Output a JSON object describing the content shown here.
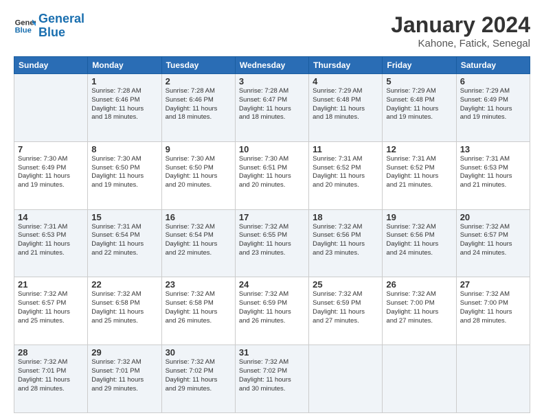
{
  "logo": {
    "text1": "General",
    "text2": "Blue"
  },
  "title": {
    "month": "January 2024",
    "location": "Kahone, Fatick, Senegal"
  },
  "headers": [
    "Sunday",
    "Monday",
    "Tuesday",
    "Wednesday",
    "Thursday",
    "Friday",
    "Saturday"
  ],
  "weeks": [
    [
      {
        "day": "",
        "info": ""
      },
      {
        "day": "1",
        "info": "Sunrise: 7:28 AM\nSunset: 6:46 PM\nDaylight: 11 hours\nand 18 minutes."
      },
      {
        "day": "2",
        "info": "Sunrise: 7:28 AM\nSunset: 6:46 PM\nDaylight: 11 hours\nand 18 minutes."
      },
      {
        "day": "3",
        "info": "Sunrise: 7:28 AM\nSunset: 6:47 PM\nDaylight: 11 hours\nand 18 minutes."
      },
      {
        "day": "4",
        "info": "Sunrise: 7:29 AM\nSunset: 6:48 PM\nDaylight: 11 hours\nand 18 minutes."
      },
      {
        "day": "5",
        "info": "Sunrise: 7:29 AM\nSunset: 6:48 PM\nDaylight: 11 hours\nand 19 minutes."
      },
      {
        "day": "6",
        "info": "Sunrise: 7:29 AM\nSunset: 6:49 PM\nDaylight: 11 hours\nand 19 minutes."
      }
    ],
    [
      {
        "day": "7",
        "info": "Sunrise: 7:30 AM\nSunset: 6:49 PM\nDaylight: 11 hours\nand 19 minutes."
      },
      {
        "day": "8",
        "info": "Sunrise: 7:30 AM\nSunset: 6:50 PM\nDaylight: 11 hours\nand 19 minutes."
      },
      {
        "day": "9",
        "info": "Sunrise: 7:30 AM\nSunset: 6:50 PM\nDaylight: 11 hours\nand 20 minutes."
      },
      {
        "day": "10",
        "info": "Sunrise: 7:30 AM\nSunset: 6:51 PM\nDaylight: 11 hours\nand 20 minutes."
      },
      {
        "day": "11",
        "info": "Sunrise: 7:31 AM\nSunset: 6:52 PM\nDaylight: 11 hours\nand 20 minutes."
      },
      {
        "day": "12",
        "info": "Sunrise: 7:31 AM\nSunset: 6:52 PM\nDaylight: 11 hours\nand 21 minutes."
      },
      {
        "day": "13",
        "info": "Sunrise: 7:31 AM\nSunset: 6:53 PM\nDaylight: 11 hours\nand 21 minutes."
      }
    ],
    [
      {
        "day": "14",
        "info": "Sunrise: 7:31 AM\nSunset: 6:53 PM\nDaylight: 11 hours\nand 21 minutes."
      },
      {
        "day": "15",
        "info": "Sunrise: 7:31 AM\nSunset: 6:54 PM\nDaylight: 11 hours\nand 22 minutes."
      },
      {
        "day": "16",
        "info": "Sunrise: 7:32 AM\nSunset: 6:54 PM\nDaylight: 11 hours\nand 22 minutes."
      },
      {
        "day": "17",
        "info": "Sunrise: 7:32 AM\nSunset: 6:55 PM\nDaylight: 11 hours\nand 23 minutes."
      },
      {
        "day": "18",
        "info": "Sunrise: 7:32 AM\nSunset: 6:56 PM\nDaylight: 11 hours\nand 23 minutes."
      },
      {
        "day": "19",
        "info": "Sunrise: 7:32 AM\nSunset: 6:56 PM\nDaylight: 11 hours\nand 24 minutes."
      },
      {
        "day": "20",
        "info": "Sunrise: 7:32 AM\nSunset: 6:57 PM\nDaylight: 11 hours\nand 24 minutes."
      }
    ],
    [
      {
        "day": "21",
        "info": "Sunrise: 7:32 AM\nSunset: 6:57 PM\nDaylight: 11 hours\nand 25 minutes."
      },
      {
        "day": "22",
        "info": "Sunrise: 7:32 AM\nSunset: 6:58 PM\nDaylight: 11 hours\nand 25 minutes."
      },
      {
        "day": "23",
        "info": "Sunrise: 7:32 AM\nSunset: 6:58 PM\nDaylight: 11 hours\nand 26 minutes."
      },
      {
        "day": "24",
        "info": "Sunrise: 7:32 AM\nSunset: 6:59 PM\nDaylight: 11 hours\nand 26 minutes."
      },
      {
        "day": "25",
        "info": "Sunrise: 7:32 AM\nSunset: 6:59 PM\nDaylight: 11 hours\nand 27 minutes."
      },
      {
        "day": "26",
        "info": "Sunrise: 7:32 AM\nSunset: 7:00 PM\nDaylight: 11 hours\nand 27 minutes."
      },
      {
        "day": "27",
        "info": "Sunrise: 7:32 AM\nSunset: 7:00 PM\nDaylight: 11 hours\nand 28 minutes."
      }
    ],
    [
      {
        "day": "28",
        "info": "Sunrise: 7:32 AM\nSunset: 7:01 PM\nDaylight: 11 hours\nand 28 minutes."
      },
      {
        "day": "29",
        "info": "Sunrise: 7:32 AM\nSunset: 7:01 PM\nDaylight: 11 hours\nand 29 minutes."
      },
      {
        "day": "30",
        "info": "Sunrise: 7:32 AM\nSunset: 7:02 PM\nDaylight: 11 hours\nand 29 minutes."
      },
      {
        "day": "31",
        "info": "Sunrise: 7:32 AM\nSunset: 7:02 PM\nDaylight: 11 hours\nand 30 minutes."
      },
      {
        "day": "",
        "info": ""
      },
      {
        "day": "",
        "info": ""
      },
      {
        "day": "",
        "info": ""
      }
    ]
  ]
}
